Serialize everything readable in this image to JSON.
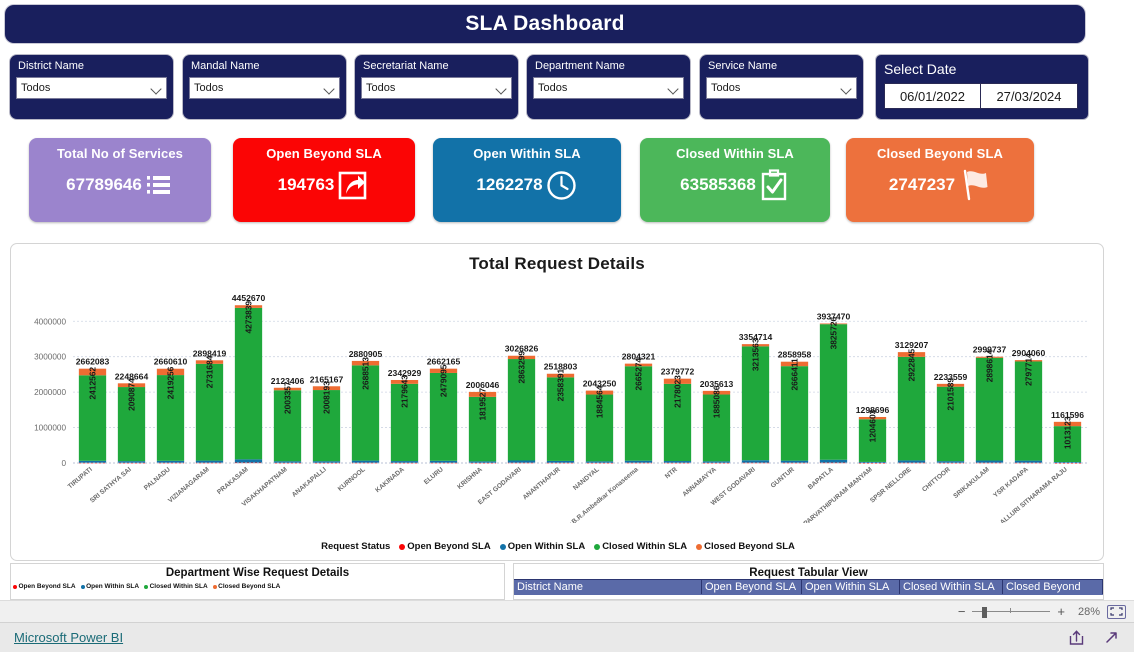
{
  "header": {
    "title": "SLA Dashboard"
  },
  "slicers": [
    {
      "label": "District Name",
      "value": "Todos",
      "icon": "chevron-down-icon"
    },
    {
      "label": "Mandal Name",
      "value": "Todos",
      "icon": "chevron-down-icon"
    },
    {
      "label": "Secretariat Name",
      "value": "Todos",
      "icon": "chevron-down-icon"
    },
    {
      "label": "Department Name",
      "value": "Todos",
      "icon": "chevron-down-icon"
    },
    {
      "label": "Service Name",
      "value": "Todos",
      "icon": "chevron-down-icon"
    }
  ],
  "date_slicer": {
    "title": "Select Date",
    "start": "06/01/2022",
    "end": "27/03/2024"
  },
  "kpis": [
    {
      "title": "Total No of Services",
      "value": "67789646",
      "color": "#9b84cd",
      "icon": "list-icon"
    },
    {
      "title": "Open Beyond SLA",
      "value": "194763",
      "color": "#fb0505",
      "icon": "share-arrow-icon"
    },
    {
      "title": "Open Within SLA",
      "value": "1262278",
      "color": "#1272a8",
      "icon": "clock-icon"
    },
    {
      "title": "Closed Within SLA",
      "value": "63585368",
      "color": "#4cb75a",
      "icon": "clipboard-check-icon"
    },
    {
      "title": "Closed Beyond SLA",
      "value": "2747237",
      "color": "#ed713d",
      "icon": "flag-icon"
    }
  ],
  "chart_data": {
    "type": "bar",
    "title": "Total Request Details",
    "xlabel": "",
    "ylabel": "",
    "ylim": [
      0,
      4600000
    ],
    "yticks": [
      0,
      1000000,
      2000000,
      3000000,
      4000000
    ],
    "ytick_labels": [
      "0",
      "1000000",
      "2000000",
      "3000000",
      "4000000"
    ],
    "grid": true,
    "stacked": true,
    "legend_title": "Request Status",
    "legend_position": "bottom",
    "series_colors": {
      "Open Beyond SLA": "#fb0505",
      "Open Within SLA": "#1272a8",
      "Closed Within SLA": "#1fa83c",
      "Closed Beyond SLA": "#ee6c32"
    },
    "legend": [
      "Open Beyond SLA",
      "Open Within SLA",
      "Closed Within SLA",
      "Closed Beyond SLA"
    ],
    "categories": [
      "TIRUPATI",
      "SRI SATHYA SAI",
      "PALNADU",
      "VIZIANAGARAM",
      "PRAKASAM",
      "VISAKHAPATNAM",
      "ANAKAPALLI",
      "KURNOOL",
      "KAKINADA",
      "ELURU",
      "KRISHNA",
      "EAST GODAVARI",
      "ANANTHAPUR",
      "NANDYAL",
      "Dr.B.R.Ambedkar Konaseema",
      "NTR",
      "ANNAMAYYA",
      "WEST GODAVARI",
      "GUNTUR",
      "BAPATLA",
      "PARVATHIPURAM MANYAM",
      "SPSR NELLORE",
      "CHITTOOR",
      "SRIKAKULAM",
      "YSR KADAPA",
      "ALLURI SITHARAMA RAJU"
    ],
    "totals": [
      2662083,
      2248664,
      2660610,
      2898419,
      4452670,
      2123406,
      2165167,
      2880905,
      2342929,
      2662165,
      2006046,
      3026826,
      2518803,
      2043250,
      2804321,
      2379772,
      2035613,
      3354714,
      2858958,
      3937470,
      1298696,
      3129207,
      2233559,
      2999737,
      2904060,
      1161596
    ],
    "closed_within_sla": [
      2412562,
      2090874,
      2419256,
      2731684,
      4273839,
      2003357,
      2008193,
      2688513,
      2179643,
      2479095,
      1819527,
      2863299,
      2358391,
      1884564,
      2665274,
      2178023,
      1885086,
      3213563,
      2666411,
      3825726,
      1204603,
      2922845,
      2101589,
      2898614,
      2797714,
      1013123
    ]
  },
  "bottom_panels": {
    "department_wise": {
      "title": "Department Wise Request Details",
      "legend": [
        "Open Beyond SLA",
        "Open Within SLA",
        "Closed Within SLA",
        "Closed Beyond SLA"
      ]
    },
    "tabular_view": {
      "title": "Request Tabular View",
      "columns": [
        "District Name",
        "Open Beyond SLA",
        "Open Within SLA",
        "Closed Within SLA",
        "Closed Beyond"
      ]
    }
  },
  "statusbar": {
    "zoom": "28%",
    "minus": "−",
    "plus": "+",
    "fit_icon": "fit-to-page-icon"
  },
  "footer": {
    "link": "Microsoft Power BI",
    "share_icon": "share-icon",
    "fullscreen_icon": "expand-icon"
  }
}
